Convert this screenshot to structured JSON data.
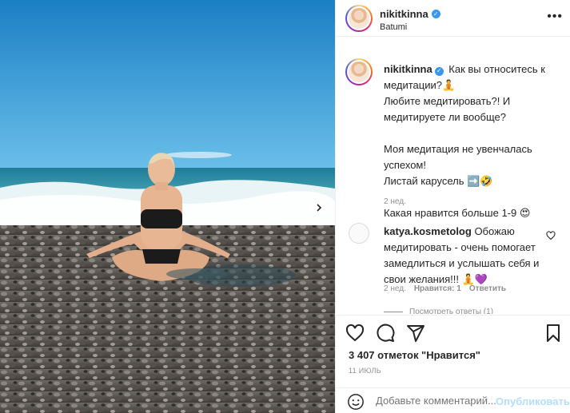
{
  "post": {
    "username": "nikitkinna",
    "location": "Batumi",
    "more_icon": "ellipsis-icon",
    "verified_icon": "verified-badge-icon"
  },
  "caption": {
    "username": "nikitkinna",
    "text": " Как вы относитесь к медитации?🧘\nЛюбите медитировать?! И медитируете ли вообще?\n\nМоя медитация не увенчалась успехом!\nЛистай карусель ➡️🤣\n\nКакая нравится больше 1-9 😍",
    "time": "2 нед."
  },
  "comment": {
    "username": "katya.kosmetolog",
    "text": " Обожаю медитировать - очень помогает замедлиться и услышать себя и свои желания!!! 🧘💜",
    "time": "2 нед.",
    "likes": "Нравится: 1",
    "reply": "Ответить",
    "view_replies": "Посмотреть ответы (1)"
  },
  "actions": {
    "likes_text": "3 407 отметок \"Нравится\"",
    "date": "11 ИЮЛЬ",
    "icons": [
      "heart-icon",
      "comment-icon",
      "share-icon",
      "bookmark-icon"
    ]
  },
  "add_comment": {
    "placeholder": "Добавьте комментарий...",
    "publish": "Опубликовать"
  },
  "colors": {
    "link": "#0095f6",
    "publish_disabled": "#b2dffc",
    "verified": "#3897f0"
  }
}
